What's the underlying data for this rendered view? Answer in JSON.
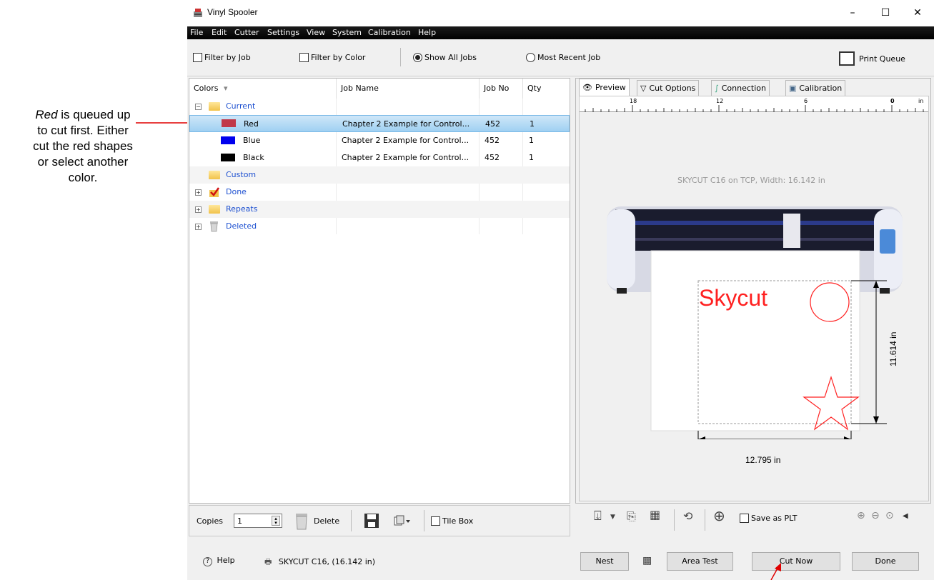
{
  "annotation": {
    "line1_italic": "Red",
    "line1_rest": " is queued up",
    "line2": "to cut first. Either",
    "line3": "cut the red shapes",
    "line4": "or select another",
    "line5": "color."
  },
  "window": {
    "title": "Vinyl Spooler",
    "minimize": "–",
    "maximize": "☐",
    "close": "✕"
  },
  "menu": [
    "File",
    "Edit",
    "Cutter",
    "Settings",
    "View",
    "System",
    "Calibration",
    "Help"
  ],
  "toolbar": {
    "filter_by_job": "Filter by Job",
    "filter_by_color": "Filter by Color",
    "show_all_jobs": "Show All Jobs",
    "most_recent_job": "Most Recent Job",
    "print_queue": "Print Queue"
  },
  "jobs_table": {
    "headers": {
      "colors": "Colors",
      "job_name": "Job Name",
      "job_no": "Job No",
      "qty": "Qty"
    },
    "groups": {
      "current": "Current",
      "custom": "Custom",
      "done": "Done",
      "repeats": "Repeats",
      "deleted": "Deleted"
    },
    "rows": [
      {
        "color": "Red",
        "swatch": "#c0394a",
        "job_name": "Chapter 2 Example for Control...",
        "job_no": "452",
        "qty": "1"
      },
      {
        "color": "Blue",
        "swatch": "#0000ee",
        "job_name": "Chapter 2 Example for Control...",
        "job_no": "452",
        "qty": "1"
      },
      {
        "color": "Black",
        "swatch": "#000000",
        "job_name": "Chapter 2 Example for Control...",
        "job_no": "452",
        "qty": "1"
      }
    ]
  },
  "left_bottom": {
    "copies_label": "Copies",
    "copies_value": "1",
    "delete_label": "Delete",
    "tile_box": "Tile Box"
  },
  "tabs": {
    "preview": "Preview",
    "cut_options": "Cut Options",
    "connection": "Connection",
    "calibration": "Calibration"
  },
  "preview": {
    "ruler_labels": [
      "18",
      "12",
      "6",
      "0",
      "in"
    ],
    "cutter_info": "SKYCUT C16 on TCP,  Width: 16.142 in",
    "design_text": "Skycut",
    "width_dim": "12.795 in",
    "height_dim": "11.614 in"
  },
  "right_bottom": {
    "save_as_plt": "Save as PLT"
  },
  "status": {
    "help": "Help",
    "cutter": "SKYCUT C16,  (16.142 in)",
    "nest": "Nest",
    "area_test": "Area Test",
    "cut_now": "Cut Now",
    "done": "Done"
  },
  "colors": {
    "selection": "#9fd0f2",
    "group_text": "#1c4fd0",
    "accent_red": "#ff0000",
    "menubar": "#000000"
  }
}
